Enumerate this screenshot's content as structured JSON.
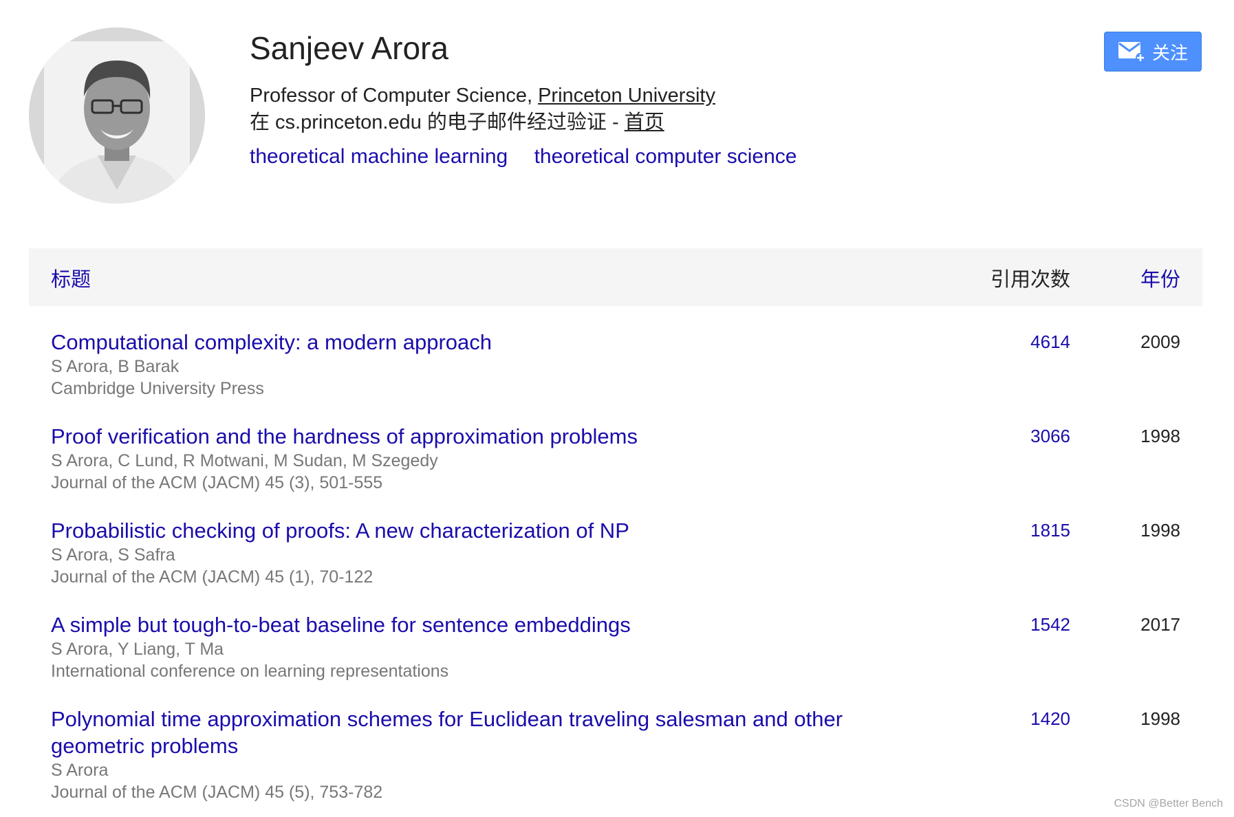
{
  "profile": {
    "name": "Sanjeev Arora",
    "affiliation_prefix": "Professor of Computer Science, ",
    "affiliation_link": "Princeton University",
    "verified_text": "在 cs.princeton.edu 的电子邮件经过验证 - ",
    "homepage_link": "首页",
    "interests": [
      "theoretical machine learning",
      "theoretical computer science"
    ],
    "follow_label": "关注"
  },
  "table": {
    "header_title": "标题",
    "header_citations": "引用次数",
    "header_year": "年份",
    "rows": [
      {
        "title": "Computational complexity: a modern approach",
        "authors": "S Arora, B Barak",
        "venue": "Cambridge University Press",
        "citations": "4614",
        "year": "2009"
      },
      {
        "title": "Proof verification and the hardness of approximation problems",
        "authors": "S Arora, C Lund, R Motwani, M Sudan, M Szegedy",
        "venue": "Journal of the ACM (JACM) 45 (3), 501-555",
        "citations": "3066",
        "year": "1998"
      },
      {
        "title": "Probabilistic checking of proofs: A new characterization of NP",
        "authors": "S Arora, S Safra",
        "venue": "Journal of the ACM (JACM) 45 (1), 70-122",
        "citations": "1815",
        "year": "1998"
      },
      {
        "title": "A simple but tough-to-beat baseline for sentence embeddings",
        "authors": "S Arora, Y Liang, T Ma",
        "venue": "International conference on learning representations",
        "citations": "1542",
        "year": "2017"
      },
      {
        "title": "Polynomial time approximation schemes for Euclidean traveling salesman and other geometric problems",
        "authors": "S Arora",
        "venue": "Journal of the ACM (JACM) 45 (5), 753-782",
        "citations": "1420",
        "year": "1998"
      }
    ]
  },
  "watermark": "CSDN @Better Bench",
  "colors": {
    "link": "#1a0dab",
    "button": "#4d90fe",
    "header_bg": "#f5f5f5",
    "meta_text": "#777777"
  },
  "icons": {
    "follow": "mail-plus-icon",
    "avatar": "profile-photo"
  }
}
